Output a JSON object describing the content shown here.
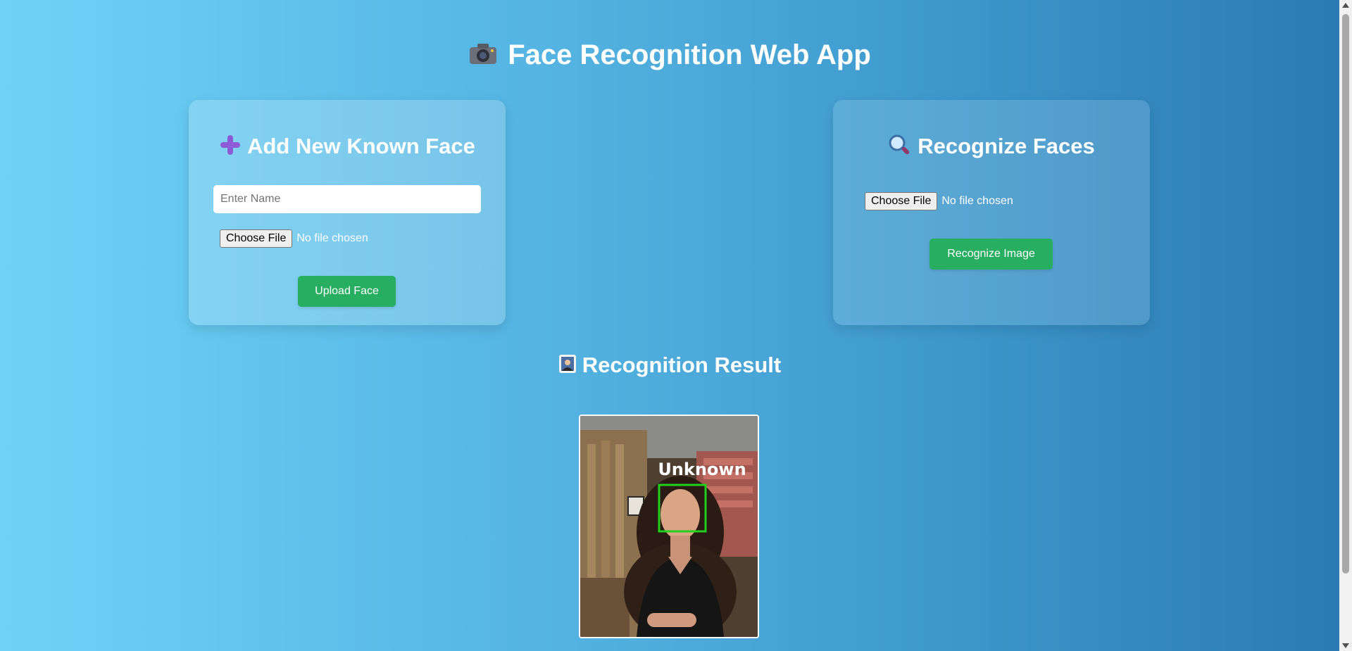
{
  "header": {
    "icon": "camera-icon",
    "title": "Face Recognition Web App"
  },
  "add_card": {
    "icon": "plus-icon",
    "title": "Add New Known Face",
    "name_placeholder": "Enter Name",
    "name_value": "",
    "choose_file_label": "Choose File",
    "file_status": "No file chosen",
    "upload_label": "Upload Face"
  },
  "recognize_card": {
    "icon": "magnifier-icon",
    "title": "Recognize Faces",
    "choose_file_label": "Choose File",
    "file_status": "No file chosen",
    "recognize_label": "Recognize Image"
  },
  "result": {
    "icon": "image-frame-icon",
    "title": "Recognition Result",
    "face_label": "Unknown",
    "box_color": "#22d11e"
  },
  "colors": {
    "accent_green": "#27ae60",
    "gradient_start": "#6fd3f7",
    "gradient_end": "#2a79b3"
  }
}
